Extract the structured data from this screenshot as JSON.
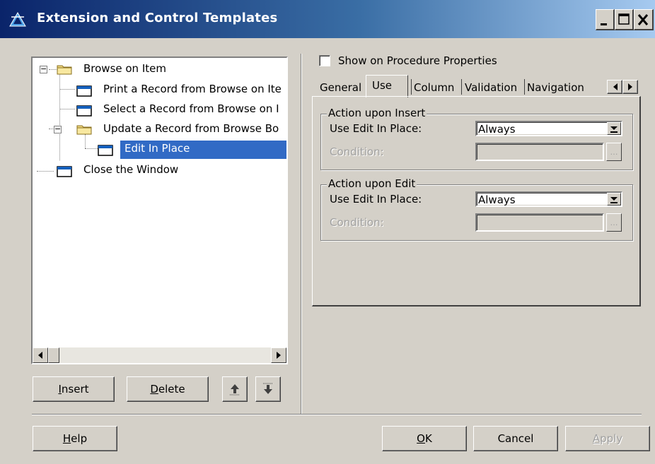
{
  "window": {
    "title": "Extension and Control Templates",
    "controls": [
      "minimize-icon",
      "maximize-icon",
      "close-icon"
    ]
  },
  "tree": {
    "items": [
      {
        "label": "Browse on Item",
        "icon": "folder-icon",
        "expander": "−"
      },
      {
        "label": "Print a Record from Browse on Ite",
        "icon": "window-icon"
      },
      {
        "label": "Select a Record from Browse on I",
        "icon": "window-icon"
      },
      {
        "label": "Update a Record from Browse Bo",
        "icon": "folder-icon",
        "expander": "−"
      },
      {
        "label": "Edit In Place",
        "icon": "window-icon",
        "selected": true
      },
      {
        "label": "Close the Window",
        "icon": "window-icon"
      }
    ]
  },
  "left_buttons": {
    "insert": {
      "first": "I",
      "rest": "nsert"
    },
    "delete": {
      "first": "D",
      "rest": "elete"
    },
    "move_up_icon": "move-up-icon",
    "move_down_icon": "move-down-icon"
  },
  "show_on_procedure_properties": {
    "label": "Show on Procedure Properties",
    "checked": false
  },
  "tabs": [
    {
      "label": "General"
    },
    {
      "label": "Use",
      "active": true
    },
    {
      "label": "Column"
    },
    {
      "label": "Validation"
    },
    {
      "label": "Navigation"
    }
  ],
  "use_tab": {
    "insert_group": {
      "title": "Action upon Insert",
      "use_label": "Use Edit In Place:",
      "use_value": "Always",
      "condition_label": "Condition:",
      "condition_value": ""
    },
    "edit_group": {
      "title": "Action upon Edit",
      "use_label": "Use Edit In Place:",
      "use_value": "Always",
      "condition_label": "Condition:",
      "condition_value": ""
    }
  },
  "bottom_buttons": {
    "help": {
      "first": "H",
      "rest": "elp"
    },
    "ok": {
      "first": "O",
      "rest": "K"
    },
    "cancel": "Cancel",
    "apply": {
      "first": "A",
      "rest": "pply",
      "disabled": true
    }
  }
}
